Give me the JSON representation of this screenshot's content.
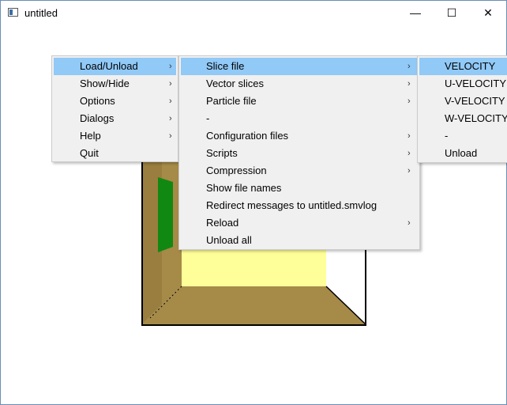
{
  "window": {
    "title": "untitled",
    "minimize_glyph": "—",
    "maximize_glyph": "☐",
    "close_glyph": "✕"
  },
  "menu_main": {
    "items": [
      {
        "label": "Load/Unload",
        "arrow": "›"
      },
      {
        "label": "Show/Hide",
        "arrow": "›"
      },
      {
        "label": "Options",
        "arrow": "›"
      },
      {
        "label": "Dialogs",
        "arrow": "›"
      },
      {
        "label": "Help",
        "arrow": "›"
      },
      {
        "label": "Quit"
      }
    ]
  },
  "menu_load": {
    "items": [
      {
        "label": "Slice file",
        "arrow": "›"
      },
      {
        "label": "Vector slices",
        "arrow": "›"
      },
      {
        "label": "Particle file",
        "arrow": "›"
      },
      {
        "label": "-"
      },
      {
        "label": "Configuration files",
        "arrow": "›"
      },
      {
        "label": "Scripts",
        "arrow": "›"
      },
      {
        "label": "Compression",
        "arrow": "›"
      },
      {
        "label": "Show file names"
      },
      {
        "label": "Redirect messages to untitled.smvlog"
      },
      {
        "label": "Reload",
        "arrow": "›"
      },
      {
        "label": "Unload all"
      }
    ]
  },
  "menu_slice": {
    "items": [
      {
        "label": "VELOCITY"
      },
      {
        "label": "U-VELOCITY"
      },
      {
        "label": "V-VELOCITY"
      },
      {
        "label": "W-VELOCITY"
      },
      {
        "label": "-"
      },
      {
        "label": "Unload"
      }
    ]
  },
  "colors": {
    "highlight": "#91c9f7",
    "menu_bg": "#f0f0f0",
    "floor": "#a68a48",
    "wall_left": "#a68a48",
    "back_wall": "#ffff99",
    "vent": "#118811"
  }
}
